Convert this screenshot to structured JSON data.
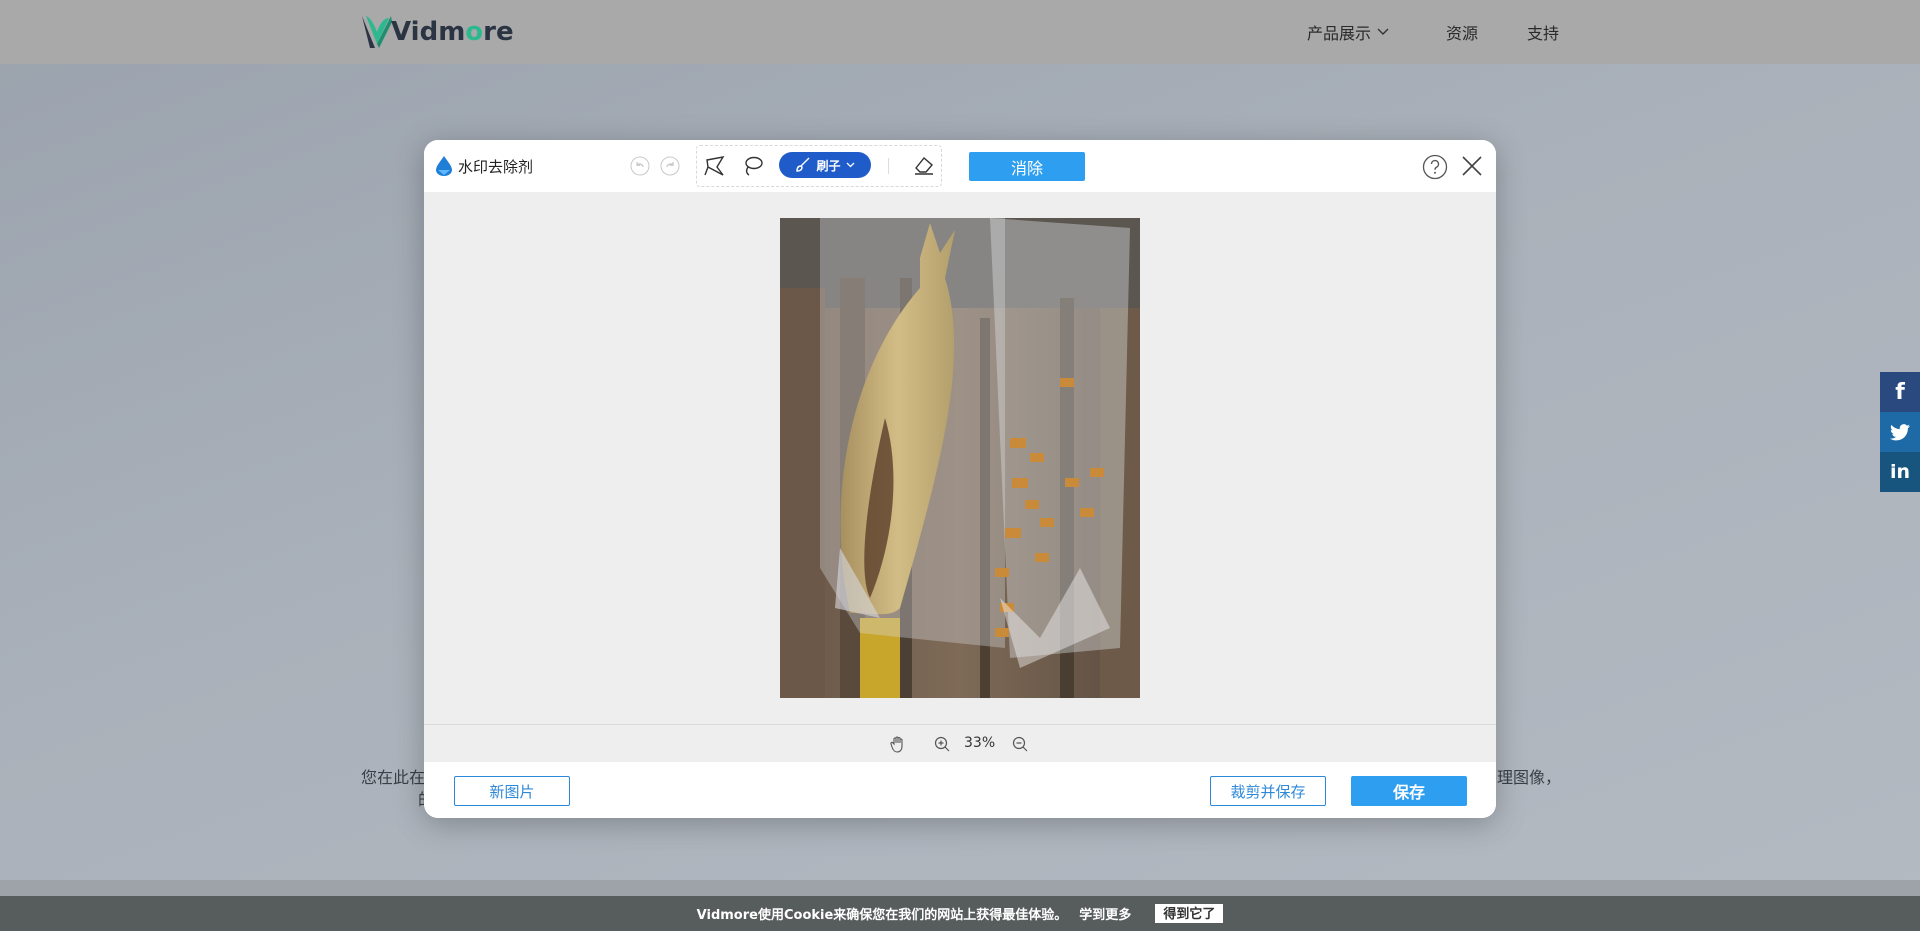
{
  "site": {
    "logo_text_pre": "Vid",
    "logo_text_mid": "m",
    "logo_text_o": "o",
    "logo_text_post": "re",
    "nav": {
      "products": "产品展示",
      "resources": "资源",
      "support": "支持"
    },
    "background_text": {
      "left_line1": "您在此在",
      "left_line2": "的",
      "right_line1": "理图像，"
    },
    "social": [
      "f",
      "t",
      "in"
    ]
  },
  "cookie_banner": {
    "message": "Vidmore使用Cookie来确保您在我们的网站上获得最佳体验。",
    "learn_more": "学到更多",
    "accept": "得到它了"
  },
  "editor": {
    "title": "水印去除剂",
    "brush_label": "刷子",
    "erase_label": "消除",
    "zoom": "33%",
    "new_image": "新图片",
    "crop_and_save": "裁剪并保存",
    "save": "保存"
  },
  "colors": {
    "accent": "#2d9ef0",
    "brush_pill": "#1f5cc9",
    "cookie_bg": "#575c5c",
    "brand_teal": "#2eb88f"
  }
}
